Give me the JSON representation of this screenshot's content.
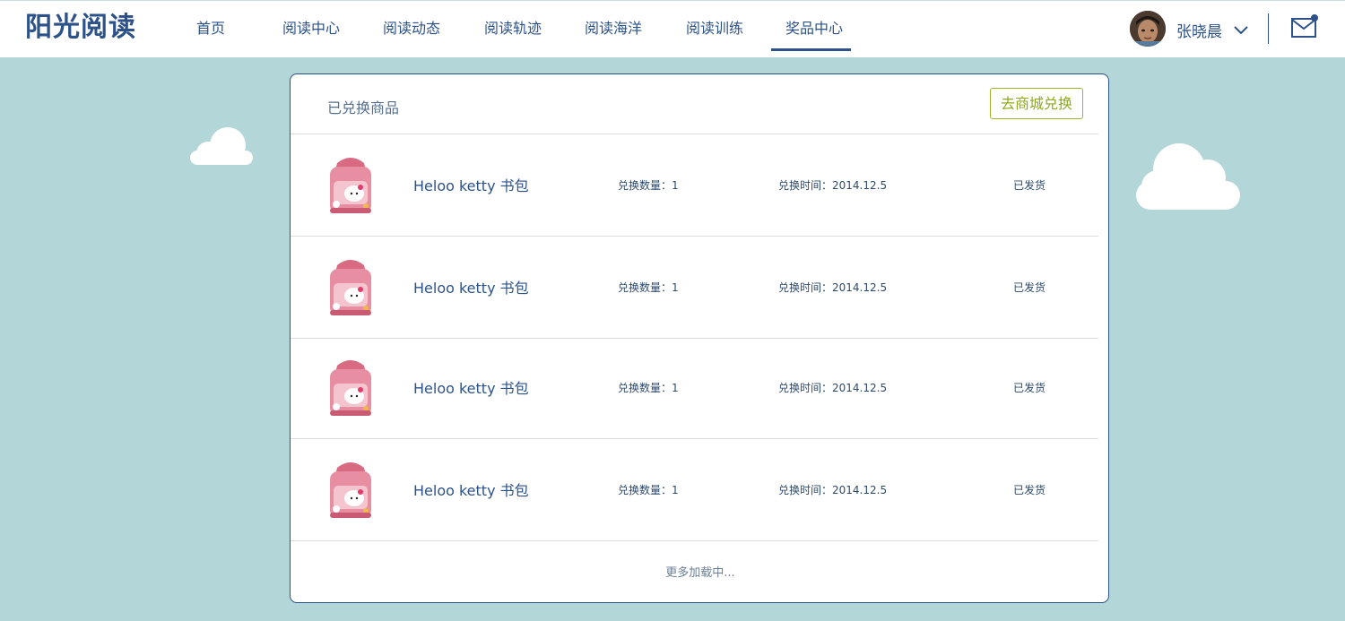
{
  "app": {
    "logo": "阳光阅读"
  },
  "nav": {
    "items": [
      {
        "label": "首页"
      },
      {
        "label": "阅读中心"
      },
      {
        "label": "阅读动态"
      },
      {
        "label": "阅读轨迹"
      },
      {
        "label": "阅读海洋"
      },
      {
        "label": "阅读训练"
      },
      {
        "label": "奖品中心"
      }
    ],
    "active": "奖品中心"
  },
  "user": {
    "name": "张晓晨",
    "has_unread_mail": true
  },
  "panel": {
    "title": "已兑换商品",
    "shop_button": "去商城兑换",
    "rows": [
      {
        "name": "Heloo ketty 书包",
        "qty": "兑换数量：1",
        "date": "兑换时间：2014.12.5",
        "status": "已发货"
      },
      {
        "name": "Heloo ketty 书包",
        "qty": "兑换数量：1",
        "date": "兑换时间：2014.12.5",
        "status": "已发货"
      },
      {
        "name": "Heloo ketty 书包",
        "qty": "兑换数量：1",
        "date": "兑换时间：2014.12.5",
        "status": "已发货"
      },
      {
        "name": "Heloo ketty 书包",
        "qty": "兑换数量：1",
        "date": "兑换时间：2014.12.5",
        "status": "已发货"
      }
    ],
    "load_more": "更多加载中..."
  },
  "colors": {
    "background": "#b3d6d8",
    "brand": "#2c5288",
    "accent_green": "#8caa1e"
  }
}
